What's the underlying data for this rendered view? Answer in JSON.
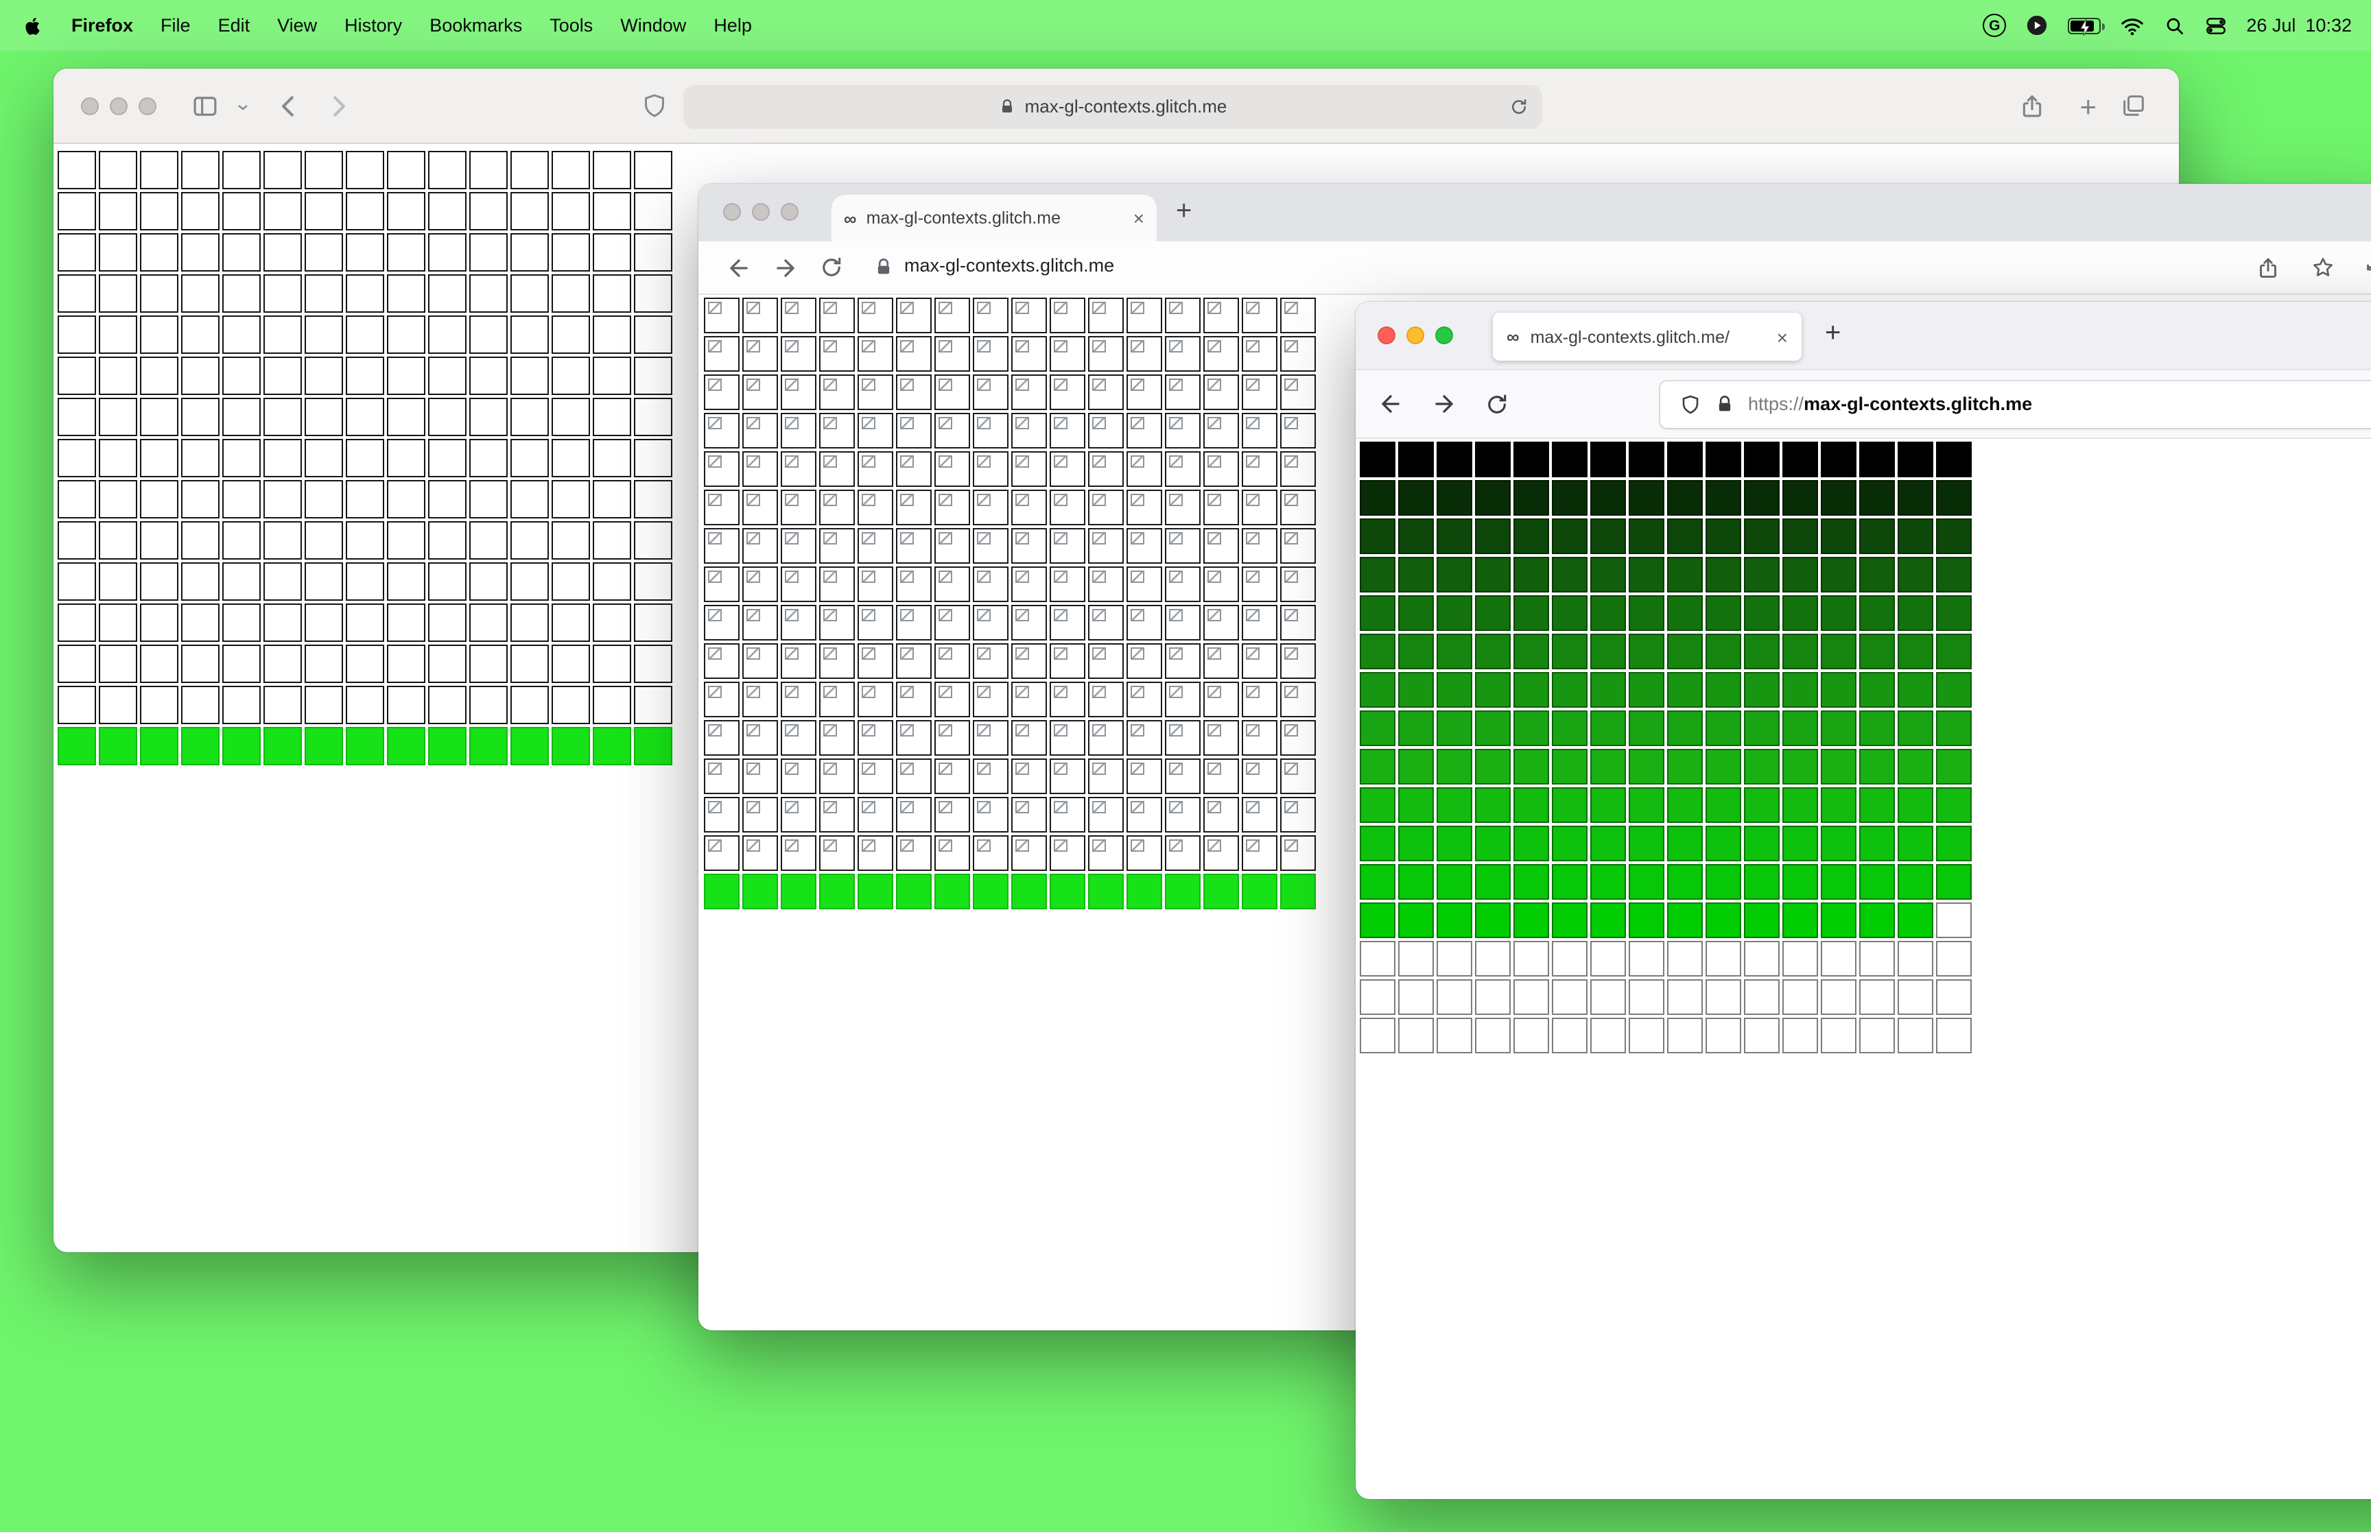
{
  "menubar": {
    "app_name": "Firefox",
    "menus": [
      "File",
      "Edit",
      "View",
      "History",
      "Bookmarks",
      "Tools",
      "Window",
      "Help"
    ],
    "status_date": "26 Jul",
    "status_time": "10:32",
    "g_badge": "G"
  },
  "colors": {
    "desktop": "#6ff46c",
    "bright_green": "#17e217"
  },
  "safari_window": {
    "url": "max-gl-contexts.glitch.me",
    "grid": {
      "cols": 15,
      "white_rows": 14,
      "green_rows": 1
    }
  },
  "chrome_window": {
    "tab_title": "max-gl-contexts.glitch.me",
    "favicon": "∞",
    "close": "×",
    "new_tab": "+",
    "url": "max-gl-contexts.glitch.me",
    "grid": {
      "cols": 16,
      "broken_rows": 15,
      "green_rows": 1
    }
  },
  "firefox_window": {
    "tab_title": "max-gl-contexts.glitch.me/",
    "favicon": "∞",
    "close": "×",
    "new_tab": "+",
    "url_scheme": "https://",
    "url_host": "max-gl-contexts.glitch.me",
    "grid": {
      "cols": 16,
      "row_colors": [
        "#000000",
        "#082c06",
        "#0d4709",
        "#115e0c",
        "#14720e",
        "#168510",
        "#189612",
        "#19a413",
        "#1ab014",
        "#13ba10",
        "#0cc20c",
        "#06c806"
      ],
      "partial_row": {
        "color": "#01cc01",
        "filled": 15
      },
      "white_rows": 3
    }
  }
}
